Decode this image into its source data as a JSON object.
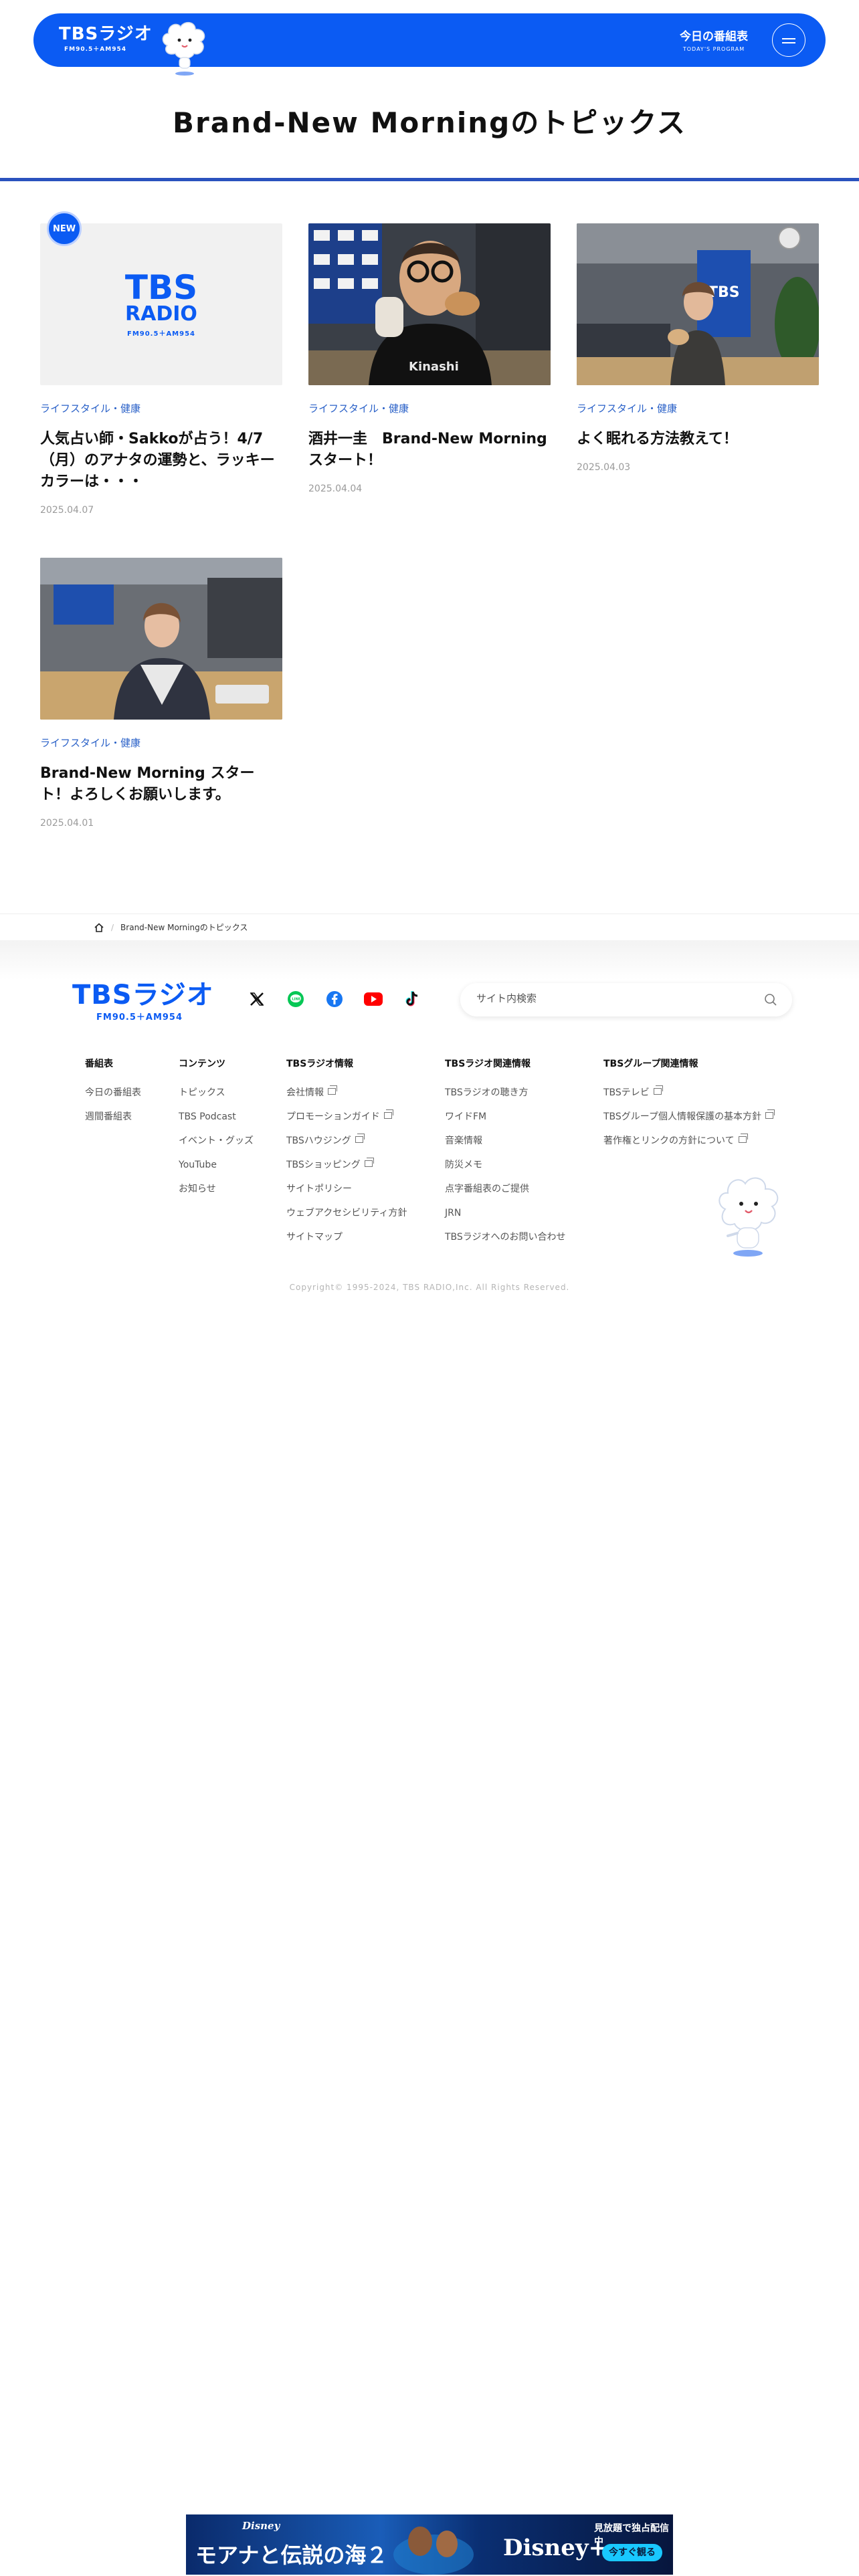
{
  "header": {
    "logo_main": "TBSラジオ",
    "logo_sub": "FM90.5＋AM954",
    "today_jp": "今日の番組表",
    "today_en": "TODAY'S PROGRAM"
  },
  "page_title": "Brand-New Morningのトピックス",
  "articles": [
    {
      "badge": "NEW",
      "logo_a": "TBS",
      "logo_b": "RADIO",
      "logo_c": "FM90.5＋AM954",
      "category": "ライフスタイル・健康",
      "title": "人気占い師・Sakkoが占う！4/7（月）のアナタの運勢と、ラッキーカラーは・・・",
      "date": "2025.04.07"
    },
    {
      "category": "ライフスタイル・健康",
      "title": "酒井一圭　Brand-New Morningスタート！",
      "date": "2025.04.04"
    },
    {
      "category": "ライフスタイル・健康",
      "title": "よく眠れる方法教えて！",
      "date": "2025.04.03"
    },
    {
      "category": "ライフスタイル・健康",
      "title": "Brand-New Morning スタート！よろしくお願いします。",
      "date": "2025.04.01"
    }
  ],
  "breadcrumb": {
    "current": "Brand-New Morningのトピックス"
  },
  "footer": {
    "logo_main": "TBSラジオ",
    "logo_sub": "FM90.5＋AM954",
    "search_placeholder": "サイト内検索",
    "columns": [
      {
        "head": "番組表",
        "links": [
          "今日の番組表",
          "週間番組表"
        ]
      },
      {
        "head": "コンテンツ",
        "links": [
          "トピックス",
          "TBS Podcast",
          "イベント・グッズ",
          "YouTube",
          "お知らせ"
        ]
      },
      {
        "head": "TBSラジオ情報",
        "links": [
          "会社情報",
          "プロモーションガイド",
          "TBSハウジング",
          "TBSショッピング",
          "サイトポリシー",
          "ウェブアクセシビリティ方針",
          "サイトマップ"
        ]
      },
      {
        "head": "TBSラジオ関連情報",
        "links": [
          "TBSラジオの聴き方",
          "ワイドFM",
          "音楽情報",
          "防災メモ",
          "点字番組表のご提供",
          "JRN",
          "TBSラジオへのお問い合わせ"
        ]
      },
      {
        "head": "TBSグループ関連情報",
        "links": [
          "TBSテレビ",
          "TBSグループ個人情報保護の基本方針",
          "著作権とリンクの方針について"
        ]
      }
    ],
    "copyright": "Copyright© 1995-2024, TBS RADIO,Inc. All Rights Reserved."
  },
  "ad": {
    "brand": "Disney",
    "title": "モアナと伝説の海２",
    "headline": "見放題で独占配信中",
    "service": "Disney+",
    "cta": "今すぐ観る"
  },
  "colors": {
    "brand_blue": "#0b5bf3",
    "category_blue": "#2a61c8",
    "rule_blue": "#2a52be"
  }
}
